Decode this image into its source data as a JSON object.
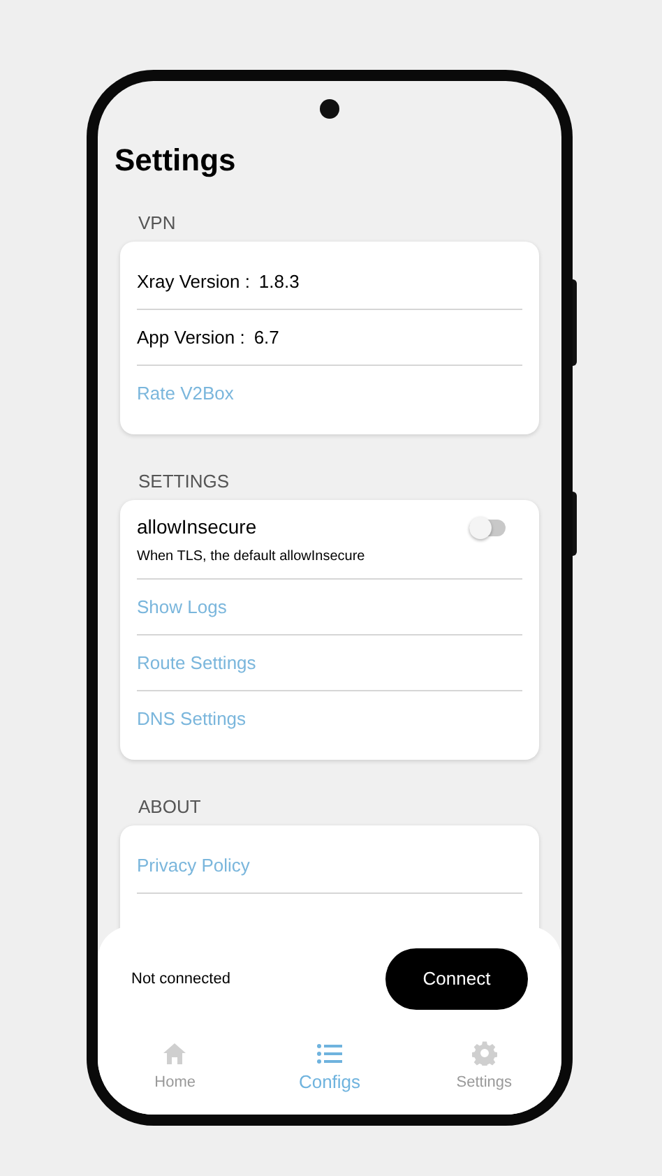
{
  "title": "Settings",
  "sections": [
    {
      "heading": "VPN",
      "items": [
        {
          "kind": "info",
          "label": "Xray Version :",
          "value": "1.8.3"
        },
        {
          "kind": "info",
          "label": "App Version :",
          "value": "6.7"
        },
        {
          "kind": "link",
          "label": "Rate V2Box"
        }
      ]
    },
    {
      "heading": "SETTINGS",
      "items": [
        {
          "kind": "toggle",
          "label": "allowInsecure",
          "description": "When TLS, the default allowInsecure",
          "on": false
        },
        {
          "kind": "link",
          "label": "Show Logs"
        },
        {
          "kind": "link",
          "label": "Route Settings"
        },
        {
          "kind": "link",
          "label": "DNS Settings"
        }
      ]
    },
    {
      "heading": "ABOUT",
      "items": [
        {
          "kind": "link",
          "label": "Privacy Policy"
        }
      ]
    }
  ],
  "connection": {
    "status": "Not connected",
    "button": "Connect"
  },
  "nav": [
    {
      "kind": "home",
      "label": "Home",
      "selected": false
    },
    {
      "kind": "list",
      "label": "Configs",
      "selected": true
    },
    {
      "kind": "gear",
      "label": "Settings",
      "selected": false
    }
  ]
}
